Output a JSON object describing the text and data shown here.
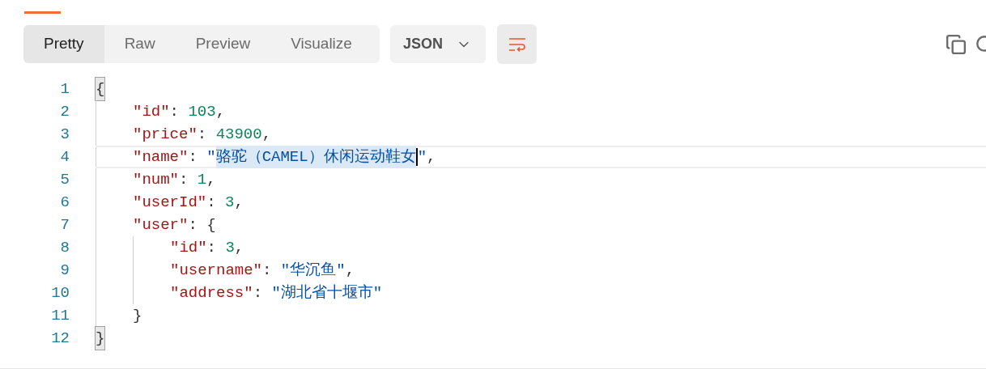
{
  "view_tabs": [
    {
      "label": "Pretty",
      "selected": true
    },
    {
      "label": "Raw",
      "selected": false
    },
    {
      "label": "Preview",
      "selected": false
    },
    {
      "label": "Visualize",
      "selected": false
    }
  ],
  "format_dropdown": {
    "value": "JSON"
  },
  "wrap_button": {
    "on": true
  },
  "code": {
    "lines": [
      {
        "number": "1",
        "current": false,
        "tokens": [
          {
            "kind": "bracket-match",
            "text": "{"
          }
        ]
      },
      {
        "number": "2",
        "current": false,
        "tokens": [
          {
            "kind": "indent"
          },
          {
            "kind": "key",
            "text": "\"id\""
          },
          {
            "kind": "punct",
            "text": ": "
          },
          {
            "kind": "number",
            "text": "103"
          },
          {
            "kind": "punct",
            "text": ","
          }
        ]
      },
      {
        "number": "3",
        "current": false,
        "tokens": [
          {
            "kind": "indent"
          },
          {
            "kind": "key",
            "text": "\"price\""
          },
          {
            "kind": "punct",
            "text": ": "
          },
          {
            "kind": "number",
            "text": "43900"
          },
          {
            "kind": "punct",
            "text": ","
          }
        ]
      },
      {
        "number": "4",
        "current": true,
        "tokens": [
          {
            "kind": "indent"
          },
          {
            "kind": "key",
            "text": "\"name\""
          },
          {
            "kind": "punct",
            "text": ": "
          },
          {
            "kind": "string",
            "text": "\""
          },
          {
            "kind": "selected-string",
            "text": "骆驼（CAMEL）休闲运动鞋女"
          },
          {
            "kind": "cursor"
          },
          {
            "kind": "string",
            "text": "\""
          },
          {
            "kind": "punct",
            "text": ","
          }
        ]
      },
      {
        "number": "5",
        "current": false,
        "tokens": [
          {
            "kind": "indent"
          },
          {
            "kind": "key",
            "text": "\"num\""
          },
          {
            "kind": "punct",
            "text": ": "
          },
          {
            "kind": "number",
            "text": "1"
          },
          {
            "kind": "punct",
            "text": ","
          }
        ]
      },
      {
        "number": "6",
        "current": false,
        "tokens": [
          {
            "kind": "indent"
          },
          {
            "kind": "key",
            "text": "\"userId\""
          },
          {
            "kind": "punct",
            "text": ": "
          },
          {
            "kind": "number",
            "text": "3"
          },
          {
            "kind": "punct",
            "text": ","
          }
        ]
      },
      {
        "number": "7",
        "current": false,
        "tokens": [
          {
            "kind": "indent"
          },
          {
            "kind": "key",
            "text": "\"user\""
          },
          {
            "kind": "punct",
            "text": ": {"
          }
        ]
      },
      {
        "number": "8",
        "current": false,
        "tokens": [
          {
            "kind": "indent"
          },
          {
            "kind": "indent"
          },
          {
            "kind": "key",
            "text": "\"id\""
          },
          {
            "kind": "punct",
            "text": ": "
          },
          {
            "kind": "number",
            "text": "3"
          },
          {
            "kind": "punct",
            "text": ","
          }
        ]
      },
      {
        "number": "9",
        "current": false,
        "tokens": [
          {
            "kind": "indent"
          },
          {
            "kind": "indent"
          },
          {
            "kind": "key",
            "text": "\"username\""
          },
          {
            "kind": "punct",
            "text": ": "
          },
          {
            "kind": "string",
            "text": "\"华沉鱼\""
          },
          {
            "kind": "punct",
            "text": ","
          }
        ]
      },
      {
        "number": "10",
        "current": false,
        "tokens": [
          {
            "kind": "indent"
          },
          {
            "kind": "indent"
          },
          {
            "kind": "key",
            "text": "\"address\""
          },
          {
            "kind": "punct",
            "text": ": "
          },
          {
            "kind": "string",
            "text": "\"湖北省十堰市\""
          }
        ]
      },
      {
        "number": "11",
        "current": false,
        "tokens": [
          {
            "kind": "indent"
          },
          {
            "kind": "punct",
            "text": "}"
          }
        ]
      },
      {
        "number": "12",
        "current": false,
        "tokens": [
          {
            "kind": "bracket-match",
            "text": "}"
          }
        ]
      }
    ]
  }
}
